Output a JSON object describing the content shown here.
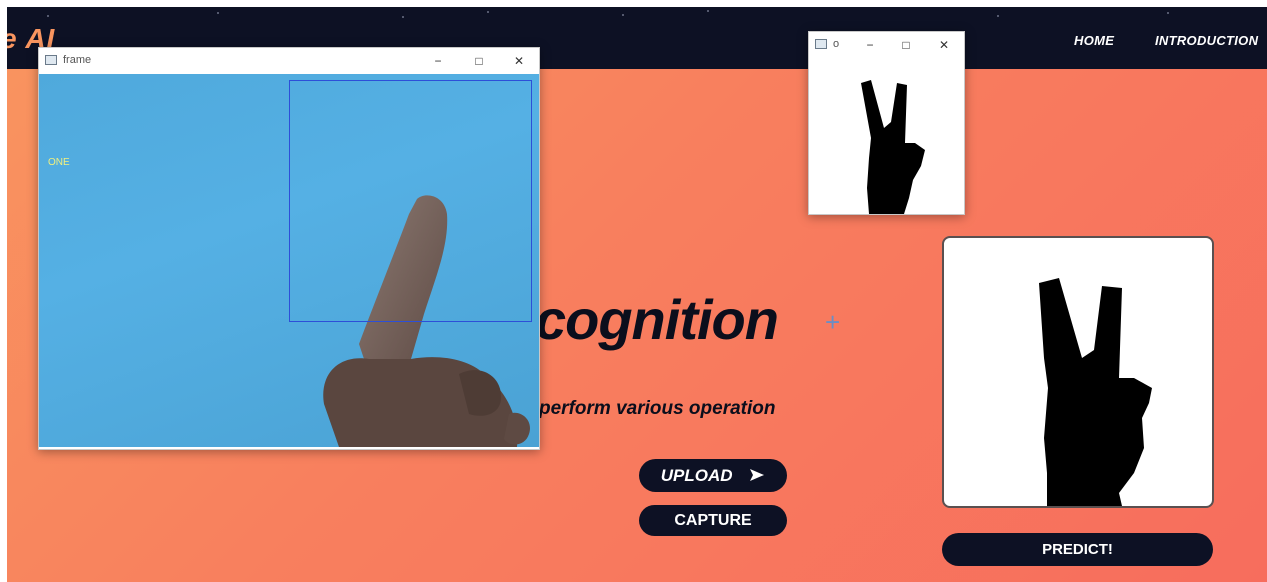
{
  "navbar": {
    "brand": "e AI",
    "links": [
      "HOME",
      "INTRODUCTION"
    ]
  },
  "hero": {
    "title_fragment": "cognition",
    "subtitle_fragment": "perform various operation"
  },
  "buttons": {
    "upload": "UPLOAD",
    "capture": "CAPTURE",
    "predict": "PREDICT!"
  },
  "camera_window": {
    "title": "frame",
    "prediction_label": "ONE"
  },
  "mask_window": {
    "title": "o"
  },
  "colors": {
    "navbar": "#0d1124",
    "accent": "#f9955f",
    "roi_box": "#2d4fd8"
  }
}
